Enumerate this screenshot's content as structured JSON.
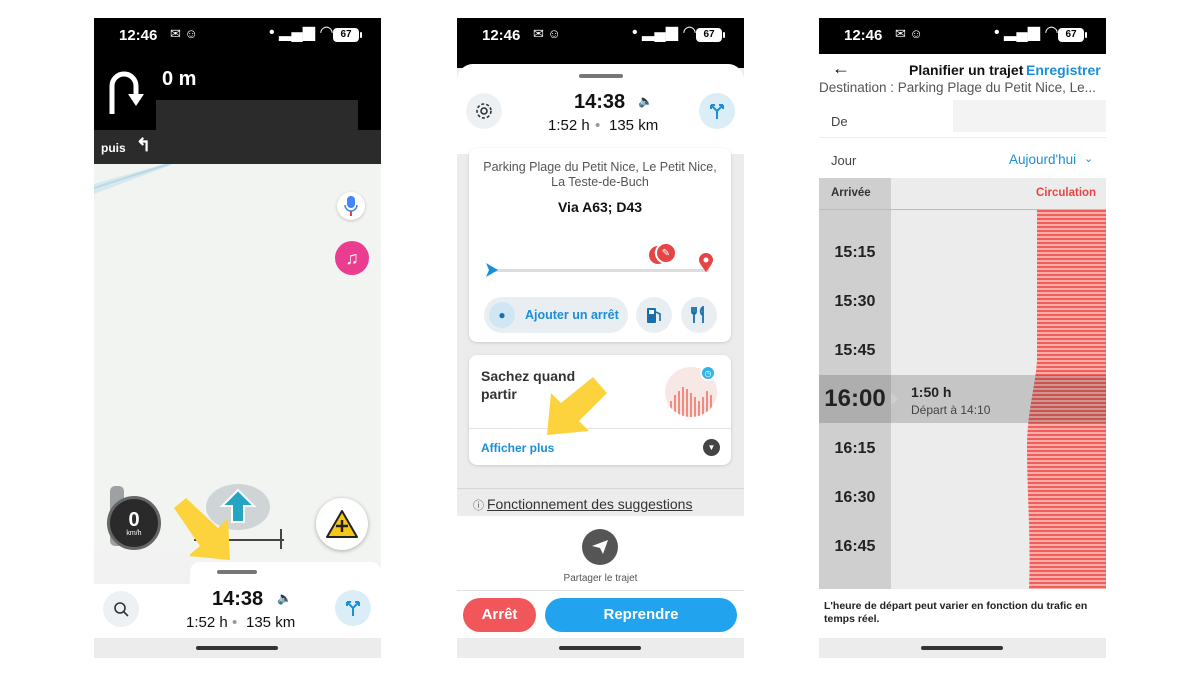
{
  "phone1": {
    "status": {
      "time": "12:46",
      "battery": "67"
    },
    "nav": {
      "distance": "0 m",
      "then_label": "puis"
    },
    "speed": {
      "value": "0",
      "unit": "km/h"
    },
    "eta": {
      "arrival": "14:38",
      "duration": "1:52 h",
      "distance": "135 km"
    }
  },
  "phone2": {
    "status": {
      "time": "12:46",
      "battery": "67"
    },
    "eta": {
      "arrival": "14:38",
      "duration": "1:52 h",
      "distance": "135 km"
    },
    "route": {
      "destination": "Parking Plage du Petit Nice, Le Petit Nice, La Teste-de-Buch",
      "via": "Via A63; D43"
    },
    "add_stop": "Ajouter un arrêt",
    "know_card": {
      "title": "Sachez quand partir",
      "more": "Afficher plus"
    },
    "suggestions_link": "Fonctionnement des suggestions",
    "share_label": "Partager le trajet",
    "stop_button": "Arrêt",
    "resume_button": "Reprendre"
  },
  "phone3": {
    "status": {
      "time": "12:46",
      "battery": "67"
    },
    "title": "Planifier un trajet",
    "save": "Enregistrer",
    "destination": "Destination : Parking Plage du Petit Nice, Le...",
    "from_label": "De",
    "day_label": "Jour",
    "day_value": "Aujourd'hui",
    "col_arrival": "Arrivée",
    "col_traffic": "Circulation",
    "times": [
      "15:15",
      "15:30",
      "15:45",
      "16:00",
      "16:15",
      "16:30",
      "16:45"
    ],
    "selected": {
      "time": "16:00",
      "duration": "1:50 h",
      "departure": "Départ à 14:10"
    },
    "footer": "L'heure de départ peut varier en fonction du trafic en temps réel."
  },
  "colors": {
    "waze_blue": "#1a8fd8",
    "stop_red": "#f0565a",
    "resume_blue": "#22a3ee",
    "traffic_red": "#f25c5c",
    "hint_arrow": "#fcd33c",
    "hazard_yellow": "#f7c717"
  }
}
